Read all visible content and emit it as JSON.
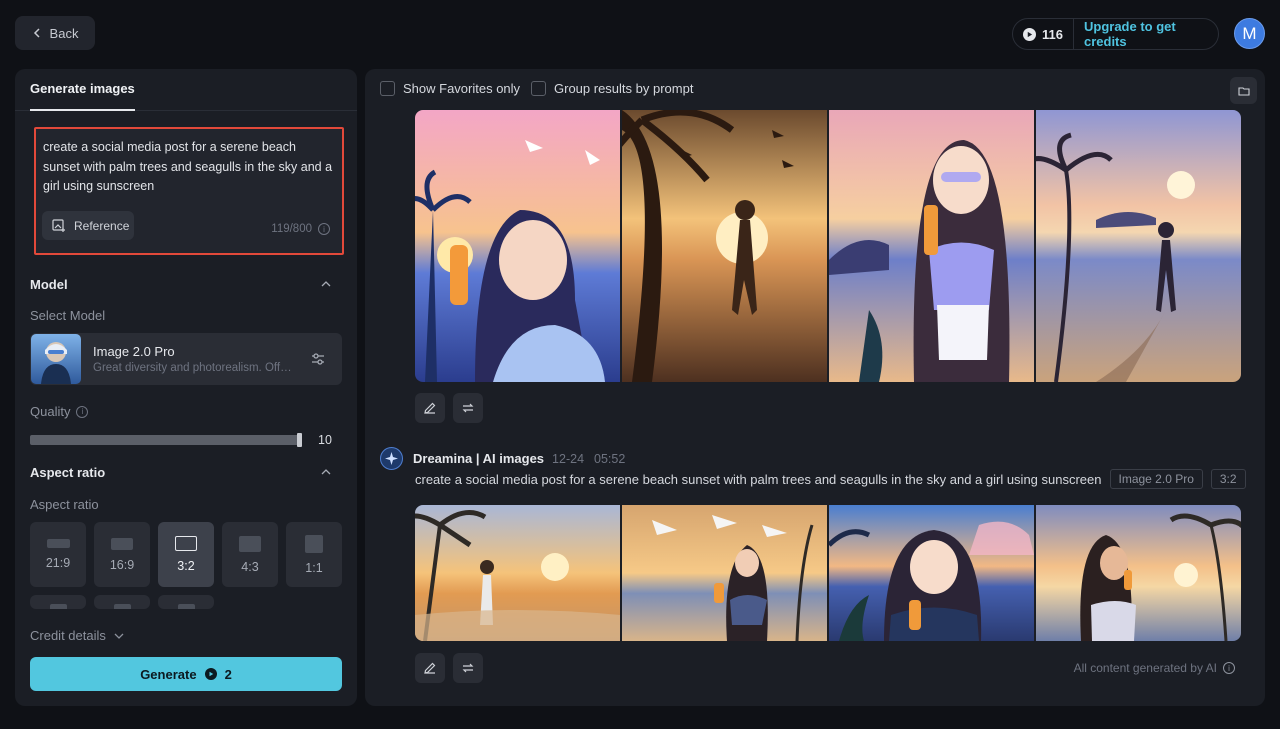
{
  "topbar": {
    "back_label": "Back",
    "credits": "116",
    "upgrade_label": "Upgrade to get credits",
    "avatar_initial": "M"
  },
  "left": {
    "tab_label": "Generate images",
    "prompt_text": "create a social media post for a serene beach sunset with palm trees and seagulls in the sky and a girl using sunscreen",
    "reference_label": "Reference",
    "char_count": "119/800",
    "model_section": "Model",
    "select_model_label": "Select Model",
    "model_name": "Image 2.0 Pro",
    "model_desc": "Great diversity and photorealism. Offers…",
    "quality_label": "Quality",
    "quality_value": "10",
    "quality_level": 1.0,
    "aspect_section": "Aspect ratio",
    "aspect_label": "Aspect ratio",
    "ratios": [
      {
        "label": "21:9"
      },
      {
        "label": "16:9"
      },
      {
        "label": "3:2"
      },
      {
        "label": "4:3"
      },
      {
        "label": "1:1"
      }
    ],
    "selected_ratio": "3:2",
    "credit_details_label": "Credit details",
    "generate_label": "Generate",
    "generate_cost": "2"
  },
  "right": {
    "show_favorites_label": "Show Favorites only",
    "group_by_prompt_label": "Group results by prompt",
    "generator_name": "Dreamina | AI images",
    "gen_date": "12-24",
    "gen_time": "05:52",
    "gen_prompt": "create a social media post for a serene beach sunset with palm trees and seagulls in the sky and a girl using sunscreen",
    "gen_model_tag": "Image 2.0 Pro",
    "gen_ratio_tag": "3:2",
    "footnote": "All content generated by AI"
  },
  "colors": {
    "accent": "#52c7df",
    "highlight_border": "#e2493a",
    "avatar": "#3d7be0"
  }
}
